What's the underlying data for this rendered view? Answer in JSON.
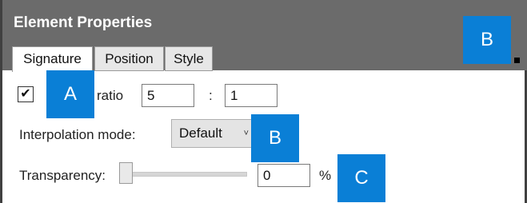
{
  "panel": {
    "title": "Element Properties"
  },
  "tabs": [
    {
      "label": "Signature",
      "active": true
    },
    {
      "label": "Position",
      "active": false
    },
    {
      "label": "Style",
      "active": false
    }
  ],
  "ratio": {
    "checked": true,
    "check_glyph": "✔",
    "label": "ratio",
    "value1": "5",
    "separator": ":",
    "value2": "1"
  },
  "interpolation": {
    "label": "Interpolation mode:",
    "selected": "Default",
    "chevron": "˅"
  },
  "transparency": {
    "label": "Transparency:",
    "value": "0",
    "unit": "%",
    "slider_level": 0
  },
  "markers": {
    "top_right": "B",
    "ratio": "A",
    "interpolation": "B",
    "transparency": "C"
  },
  "colors": {
    "marker_blue": "#0a7fd6",
    "title_bar": "#6b6b6b"
  }
}
